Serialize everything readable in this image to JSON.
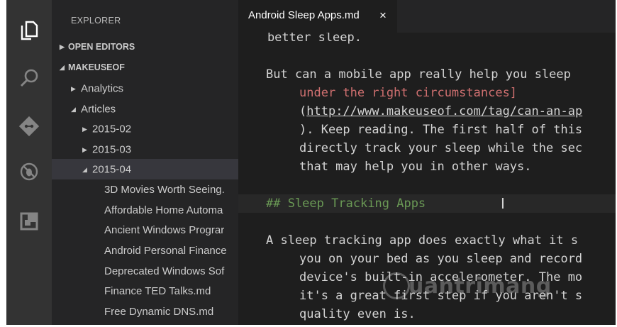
{
  "activity_bar": {
    "icons": [
      "files-icon",
      "search-icon",
      "git-icon",
      "debug-icon",
      "extensions-icon"
    ]
  },
  "sidebar": {
    "title": "EXPLORER",
    "open_editors": "OPEN EDITORS",
    "workspace": "MAKEUSEOF",
    "tree": [
      {
        "label": "Analytics",
        "arrow": "▶"
      },
      {
        "label": "Articles",
        "arrow": "◢"
      },
      {
        "label": "2015-02",
        "arrow": "▶"
      },
      {
        "label": "2015-03",
        "arrow": "▶"
      },
      {
        "label": "2015-04",
        "arrow": "◢"
      }
    ],
    "files": [
      "3D Movies Worth Seeing.",
      "Affordable Home Automa",
      "Ancient Windows Prograr",
      "Android Personal Finance",
      "Deprecated Windows Sof",
      "Finance TED Talks.md",
      "Free Dynamic DNS.md"
    ]
  },
  "tab": {
    "title": "Android Sleep Apps.md",
    "close": "×"
  },
  "editor": {
    "l0": "    better sleep.",
    "l1": "But can a mobile app really help you sleep",
    "l2": "under the right circumstances]",
    "l3_open": "(",
    "l3_link": "http://www.makeuseof.com/tag/can-an-ap",
    "l4": "). Keep reading. The first half of this",
    "l5": "directly track your sleep while the sec",
    "l6": "that may help you in other ways.",
    "l7": "## Sleep Tracking Apps",
    "l8": "A sleep tracking app does exactly what it s",
    "l9": "you on your bed as you sleep and record",
    "l10": "device's built-in accelerometer. The mo",
    "l11": "it's a great first step if you aren't s",
    "l12": "quality even is.",
    "cursor": "I"
  },
  "watermark": "uantrimang"
}
